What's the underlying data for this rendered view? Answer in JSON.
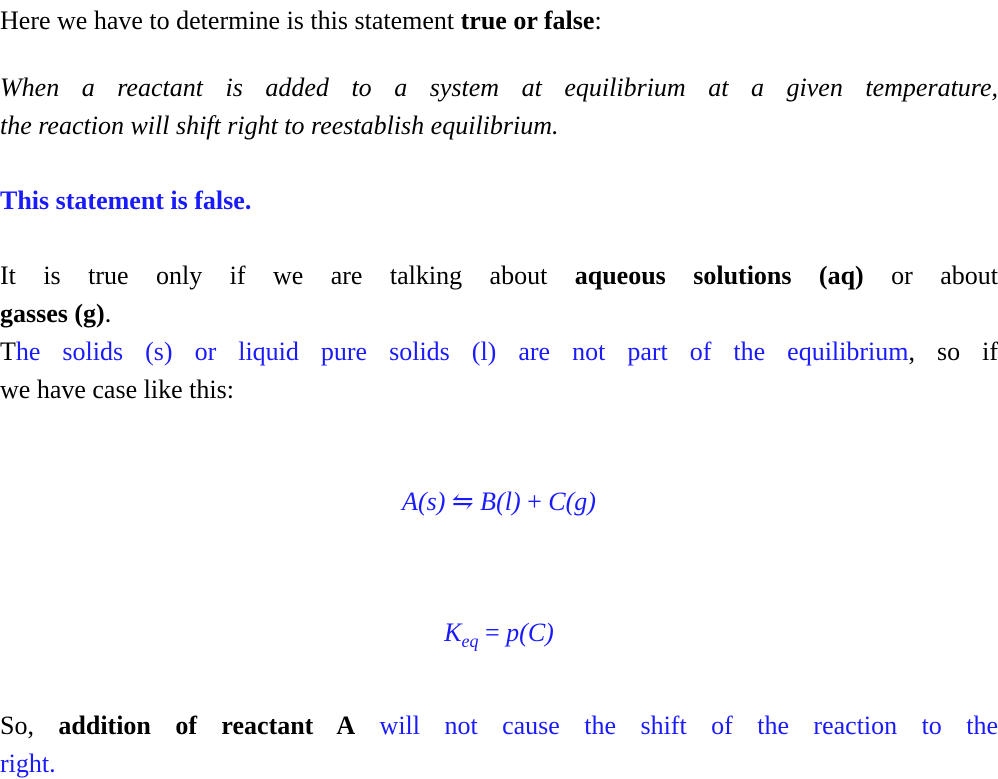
{
  "intro": {
    "prefix": "Here we have to determine is this statement ",
    "bold": "true or false",
    "suffix": ":"
  },
  "statement": {
    "line1": "When a reactant is added to a system at equilibrium at a given temperature,",
    "line2": "the reaction will shift right to reestablish equilibrium."
  },
  "verdict": "This statement is false.",
  "explanation": {
    "line1_prefix": "It is true only if we are talking about ",
    "line1_bold": "aqueous solutions (aq)",
    "line1_suffix": " or about",
    "line2_bold": "gasses (g)",
    "line2_suffix": ".",
    "line3_black": "T",
    "line3_blue": "he solids (s) or liquid pure solids (l) are not part of the equilibrium",
    "line3_suffix": ", so if",
    "line4": "we have case like this:"
  },
  "equations": {
    "reaction": {
      "reactant": "A",
      "reactant_state": "(s)",
      "arrow": "⇋",
      "product1": "B",
      "product1_state": "(l)",
      "plus": "+",
      "product2": "C",
      "product2_state": "(g)"
    },
    "keq": {
      "symbol": "K",
      "subscript": "eq",
      "equals": "=",
      "rhs": "p(C)"
    }
  },
  "conclusion": {
    "prefix": "So, ",
    "bold": "addition of reactant A",
    "blue_line1": " will not cause the shift of the reaction to the",
    "blue_line2": "right",
    "suffix": "."
  },
  "colors": {
    "text": "#000000",
    "accent_blue": "#1a1aff",
    "background": "#ffffff"
  }
}
